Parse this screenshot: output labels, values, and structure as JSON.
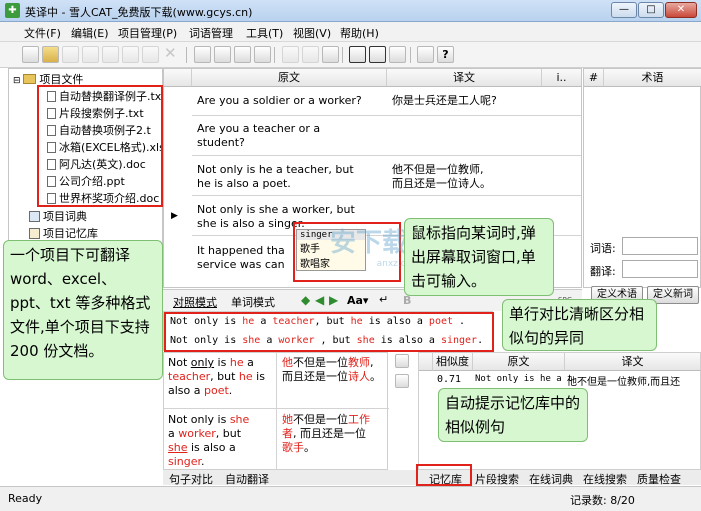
{
  "window": {
    "title": "英译中 - 雪人CAT_免费版下载(www.gcys.cn)",
    "minimize": "—",
    "maximize": "□",
    "close": "✕"
  },
  "menu": [
    "文件(F)",
    "编辑(E)",
    "项目管理(P)",
    "词语管理",
    "工具(T)",
    "视图(V)",
    "帮助(H)"
  ],
  "tree": {
    "root": "项目文件",
    "files": [
      "自动替换翻译例子.tx",
      "片段搜索例子.txt",
      "自动替换项例子2.t",
      "冰箱(EXCEL格式).xls",
      "阿凡达(英文).doc",
      "公司介绍.ppt",
      "世界杯奖项介绍.doc"
    ],
    "dictionary": "项目词典",
    "memory": "项目记忆库"
  },
  "grid": {
    "headers": {
      "source": "原文",
      "target": "译文",
      "flag": "i..",
      "num": "#",
      "term": "术语"
    },
    "rows": [
      {
        "source": "Are you a soldier or a worker?",
        "target": "你是士兵还是工人呢?"
      },
      {
        "source": "Are you a teacher or a\nstudent?",
        "target": ""
      },
      {
        "source": "Not only is he a teacher, but\nhe is also a poet.",
        "target": "他不但是一位教师,\n而且还是一位诗人。"
      },
      {
        "source": "Not only is she a worker, but\nshe is also a singer.",
        "target": ""
      },
      {
        "source": "It happened tha\nservice was can",
        "target": ""
      }
    ]
  },
  "popup": {
    "word": "singer",
    "options": [
      "歌手",
      "歌唱家"
    ]
  },
  "term_panel": {
    "word_label": "词语:",
    "translation_label": "翻译:",
    "define_term": "定义术语",
    "define_word": "定义新词"
  },
  "modes": {
    "compare": "对照模式",
    "single": "单词模式",
    "aa": "Aa▾",
    "src": "SRC"
  },
  "compare": {
    "line1": [
      "Not only is ",
      "he",
      " a ",
      "teacher",
      ", but ",
      "he",
      " is also a ",
      "poet",
      " ."
    ],
    "line2": [
      "Not only is ",
      "she",
      " a ",
      "worker",
      " , but ",
      "she",
      " is also a ",
      "singer",
      "."
    ]
  },
  "bottom_left": {
    "en1": [
      "Not ",
      "only",
      " is ",
      "he",
      " a ",
      "teacher",
      ", but ",
      "he",
      " is also a ",
      "poet",
      "."
    ],
    "zh1": [
      "他",
      "不但是一位",
      "教师",
      ", 而且还是一位",
      "诗人",
      "。"
    ],
    "en2": [
      "Not only is ",
      "she",
      " a ",
      "worker",
      ", but ",
      "she",
      " is also a ",
      "singer",
      "."
    ],
    "zh2": [
      "她",
      "不但是一位",
      "工作者",
      ", 而且还是一位",
      "歌手",
      "。"
    ]
  },
  "memory": {
    "headers": [
      "相似度",
      "原文",
      "译文"
    ],
    "row": {
      "score": "0.71",
      "source": "Not only is he a t",
      "target": "他不但是一位教师,而且还"
    }
  },
  "bottom_tabs": [
    "句子对比",
    "自动翻译",
    "记忆库",
    "片段搜索",
    "在线词典",
    "在线搜索",
    "质量检查"
  ],
  "status": {
    "left": "Ready",
    "right": "记录数: 8/20"
  },
  "callouts": {
    "left": "一个项目下可翻译word、excel、ppt、txt 等多种格式文件,单个项目下支持 200 份文档。",
    "word": "鼠标指向某词时,弹出屏幕取词窗口,单击可输入。",
    "compare": "单行对比清晰区分相似句的异同",
    "memory": "自动提示记忆库中的相似例句"
  },
  "watermark": "安下载",
  "watermark_sub": "anxz.com"
}
